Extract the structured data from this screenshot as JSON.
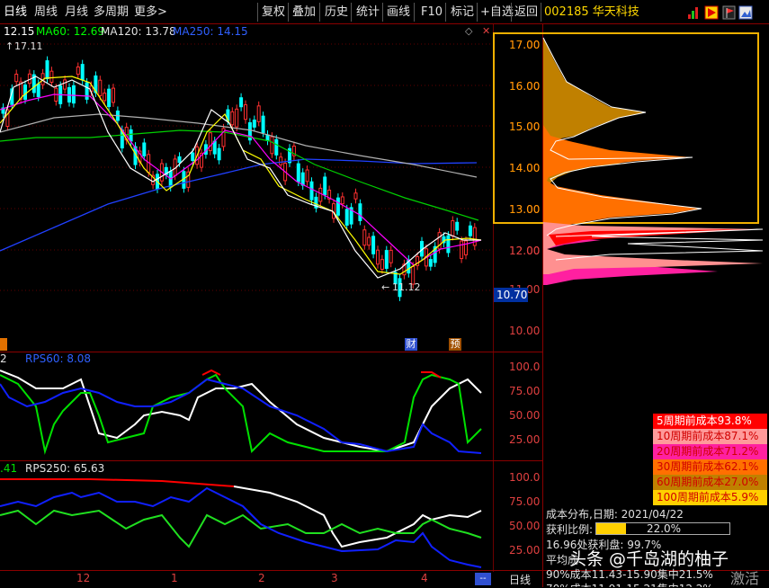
{
  "toolbar": {
    "left_tabs": [
      "日线",
      "周线",
      "月线",
      "多周期",
      "更多>"
    ],
    "right_buttons": [
      "复权",
      "叠加",
      "历史",
      "统计",
      "画线",
      "F10",
      "标记",
      "+自选",
      "返回"
    ]
  },
  "stock": {
    "code_name": "002185 华天科技"
  },
  "ma_legend": {
    "close": "12.15",
    "ma60": "MA60: 12.69",
    "ma120": "MA120: 13.78",
    "ma250": "MA250: 14.15"
  },
  "price_panel": {
    "high_label": "17.11",
    "low_label": "11.12",
    "current_price_box": "10.70",
    "axis_labels": [
      "17.00",
      "16.00",
      "15.00",
      "14.00",
      "13.00",
      "12.00",
      "11.00",
      "10.00"
    ],
    "event_markers": [
      "财",
      "预"
    ]
  },
  "rps60_panel": {
    "label": "RPS60: 8.08",
    "left_value": "2",
    "axis_labels": [
      "100.0",
      "75.00",
      "50.00",
      "25.00"
    ]
  },
  "rps250_panel": {
    "label": "RPS250: 65.63",
    "left_value": ".41",
    "axis_labels": [
      "100.0",
      "75.00",
      "50.00",
      "25.00"
    ]
  },
  "x_axis": {
    "months": [
      "12",
      "1",
      "2",
      "3",
      "4"
    ],
    "period_label": "日线"
  },
  "chip_distribution": {
    "legend": [
      {
        "label": "5周期前成本93.8%",
        "color": "#ff0000"
      },
      {
        "label": "10周期前成本87.1%",
        "color": "#ff9090"
      },
      {
        "label": "20周期前成本71.2%",
        "color": "#ff20a0"
      },
      {
        "label": "30周期前成本62.1%",
        "color": "#ff7000"
      },
      {
        "label": "60周期前成本27.0%",
        "color": "#c08000"
      },
      {
        "label": "100周期前成本5.9%",
        "color": "#ffd000"
      }
    ],
    "date_line": "成本分布,日期: 2021/04/22",
    "profit_ratio_label": "获利比例:",
    "profit_ratio_value": "22.0%",
    "profit_ratio_fraction": 0.22,
    "profit_line": "16.96处获利盘: 99.7%",
    "avg_cost_label": "平均成",
    "cost90_line": "90%成本11.43-15.90集中21.5%",
    "cost70_line": "70%成本11.91-15.21集中12.2%"
  },
  "watermark": {
    "brand": "头条 @千岛湖的柚子",
    "overlay": "激活"
  },
  "colors": {
    "up": "#ff3030",
    "down": "#00ffff",
    "ma5": "#ffffff",
    "ma10": "#ffff00",
    "ma20": "#ff00ff",
    "ma60": "#00ff00",
    "ma120": "#c0c0c0",
    "ma250": "#2040ff",
    "highlight_box": "#f0b000"
  }
}
